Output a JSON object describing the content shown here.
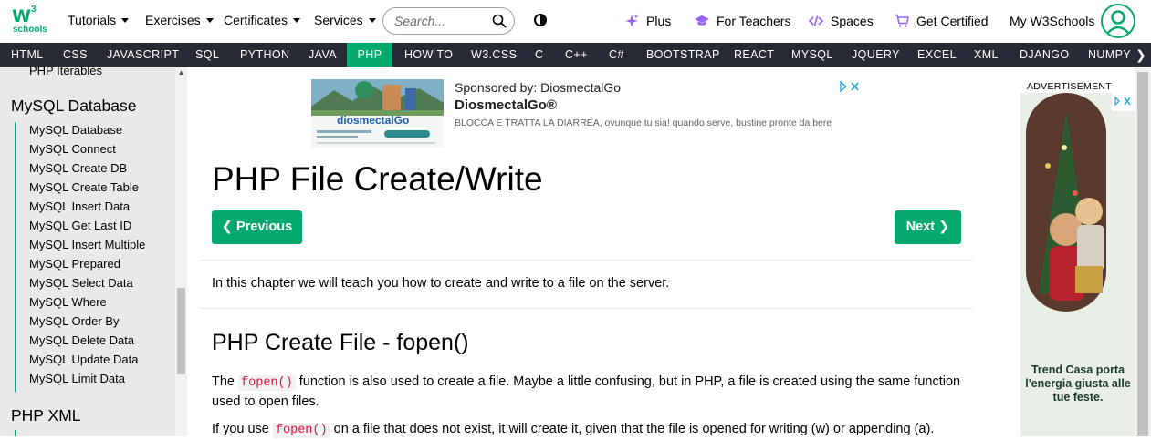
{
  "logo": {
    "mark": "W",
    "sup": "3",
    "text": "schools"
  },
  "header": {
    "menus": [
      {
        "label": "Tutorials"
      },
      {
        "label": "Exercises"
      },
      {
        "label": "Certificates"
      },
      {
        "label": "Services"
      }
    ],
    "search": {
      "placeholder": "Search..."
    },
    "links": {
      "plus": "Plus",
      "teachers": "For Teachers",
      "spaces": "Spaces",
      "certified": "Get Certified",
      "my": "My W3Schools"
    }
  },
  "navbar": {
    "items": [
      "HTML",
      "CSS",
      "JAVASCRIPT",
      "SQL",
      "PYTHON",
      "JAVA",
      "PHP",
      "HOW TO",
      "W3.CSS",
      "C",
      "C++",
      "C#",
      "BOOTSTRAP",
      "REACT",
      "MYSQL",
      "JQUERY",
      "EXCEL",
      "XML",
      "DJANGO",
      "NUMPY"
    ],
    "active": "PHP"
  },
  "sidebar": {
    "top_item": "PHP Iterables",
    "section_title": "MySQL Database",
    "items": [
      "MySQL Database",
      "MySQL Connect",
      "MySQL Create DB",
      "MySQL Create Table",
      "MySQL Insert Data",
      "MySQL Get Last ID",
      "MySQL Insert Multiple",
      "MySQL Prepared",
      "MySQL Select Data",
      "MySQL Where",
      "MySQL Order By",
      "MySQL Delete Data",
      "MySQL Update Data",
      "MySQL Limit Data"
    ],
    "next_section_title": "PHP XML"
  },
  "ad": {
    "sponsor": "Sponsored by: DiosmectalGo",
    "brand": "DiosmectalGo®",
    "description": "BLOCCA E TRATTA LA DIARREA, ovunque tu sia! quando serve, bustine pronte da bere",
    "image_brand": "diosmectalGo"
  },
  "content": {
    "title": "PHP File Create/Write",
    "prev_label": "Previous",
    "next_label": "Next",
    "intro": "In this chapter we will teach you how to create and write to a file on the server.",
    "h2": "PHP Create File - fopen()",
    "p1_a": "The ",
    "p1_code": "fopen()",
    "p1_b": " function is also used to create a file. Maybe a little confusing, but in PHP, a file is created using the same function",
    "p1_c": "used to open files.",
    "p2_a": "If you use ",
    "p2_code": "fopen()",
    "p2_b": " on a file that does not exist, it will create it, given that the file is opened for writing (w) or appending (a)."
  },
  "right_ad": {
    "label": "ADVERTISEMENT",
    "text": "Trend Casa porta l'energia giusta alle tue feste."
  },
  "colors": {
    "accent": "#04AA6D",
    "navbar": "#282A35",
    "sidebar": "#E7E9EB",
    "code": "#dc143c"
  }
}
